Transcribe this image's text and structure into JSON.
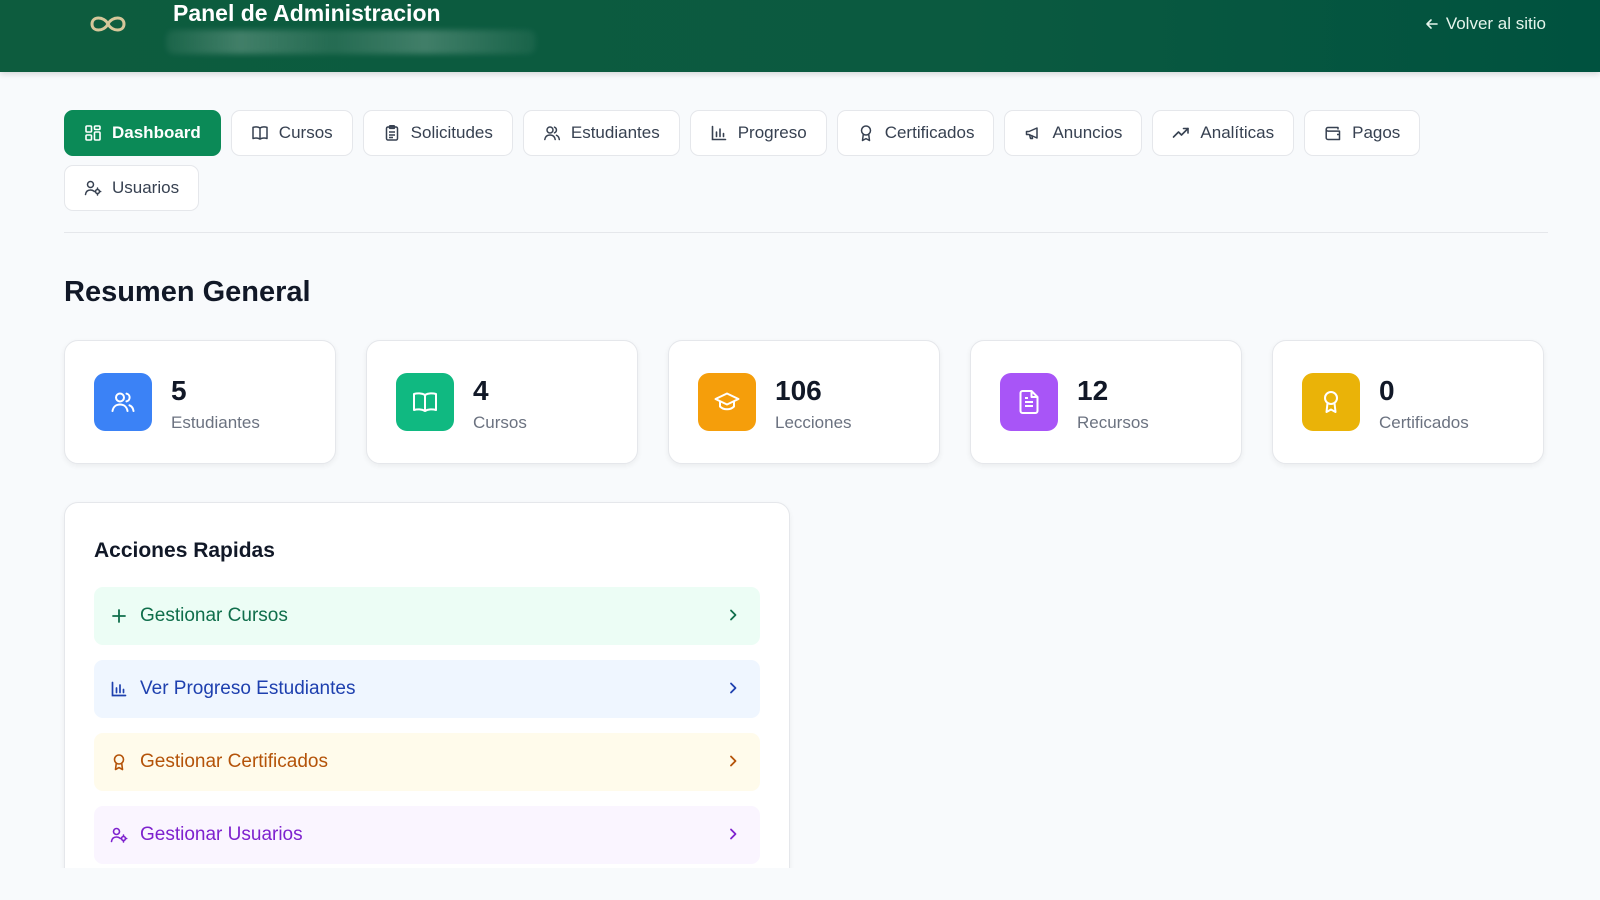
{
  "header": {
    "title": "Panel de Administracion",
    "back_label": "Volver al sitio"
  },
  "nav": {
    "items": [
      {
        "label": "Dashboard",
        "icon": "grid-icon",
        "active": true
      },
      {
        "label": "Cursos",
        "icon": "book-icon"
      },
      {
        "label": "Solicitudes",
        "icon": "clipboard-icon"
      },
      {
        "label": "Estudiantes",
        "icon": "users-icon"
      },
      {
        "label": "Progreso",
        "icon": "bar-chart-icon"
      },
      {
        "label": "Certificados",
        "icon": "award-icon"
      },
      {
        "label": "Anuncios",
        "icon": "megaphone-icon"
      },
      {
        "label": "Analíticas",
        "icon": "trending-up-icon"
      },
      {
        "label": "Pagos",
        "icon": "wallet-icon"
      },
      {
        "label": "Usuarios",
        "icon": "user-cog-icon"
      }
    ]
  },
  "summary": {
    "title": "Resumen General",
    "stats": [
      {
        "value": "5",
        "label": "Estudiantes",
        "icon": "users-icon",
        "color": "#3b82f6"
      },
      {
        "value": "4",
        "label": "Cursos",
        "icon": "book-icon",
        "color": "#10b981"
      },
      {
        "value": "106",
        "label": "Lecciones",
        "icon": "graduation-cap-icon",
        "color": "#f59e0b"
      },
      {
        "value": "12",
        "label": "Recursos",
        "icon": "file-text-icon",
        "color": "#a855f7"
      },
      {
        "value": "0",
        "label": "Certificados",
        "icon": "award-icon",
        "color": "#eab308"
      }
    ]
  },
  "quick_actions": {
    "title": "Acciones Rapidas",
    "items": [
      {
        "label": "Gestionar Cursos",
        "icon": "plus-icon"
      },
      {
        "label": "Ver Progreso Estudiantes",
        "icon": "bar-chart-icon"
      },
      {
        "label": "Gestionar Certificados",
        "icon": "award-icon"
      },
      {
        "label": "Gestionar Usuarios",
        "icon": "user-cog-icon"
      }
    ]
  }
}
